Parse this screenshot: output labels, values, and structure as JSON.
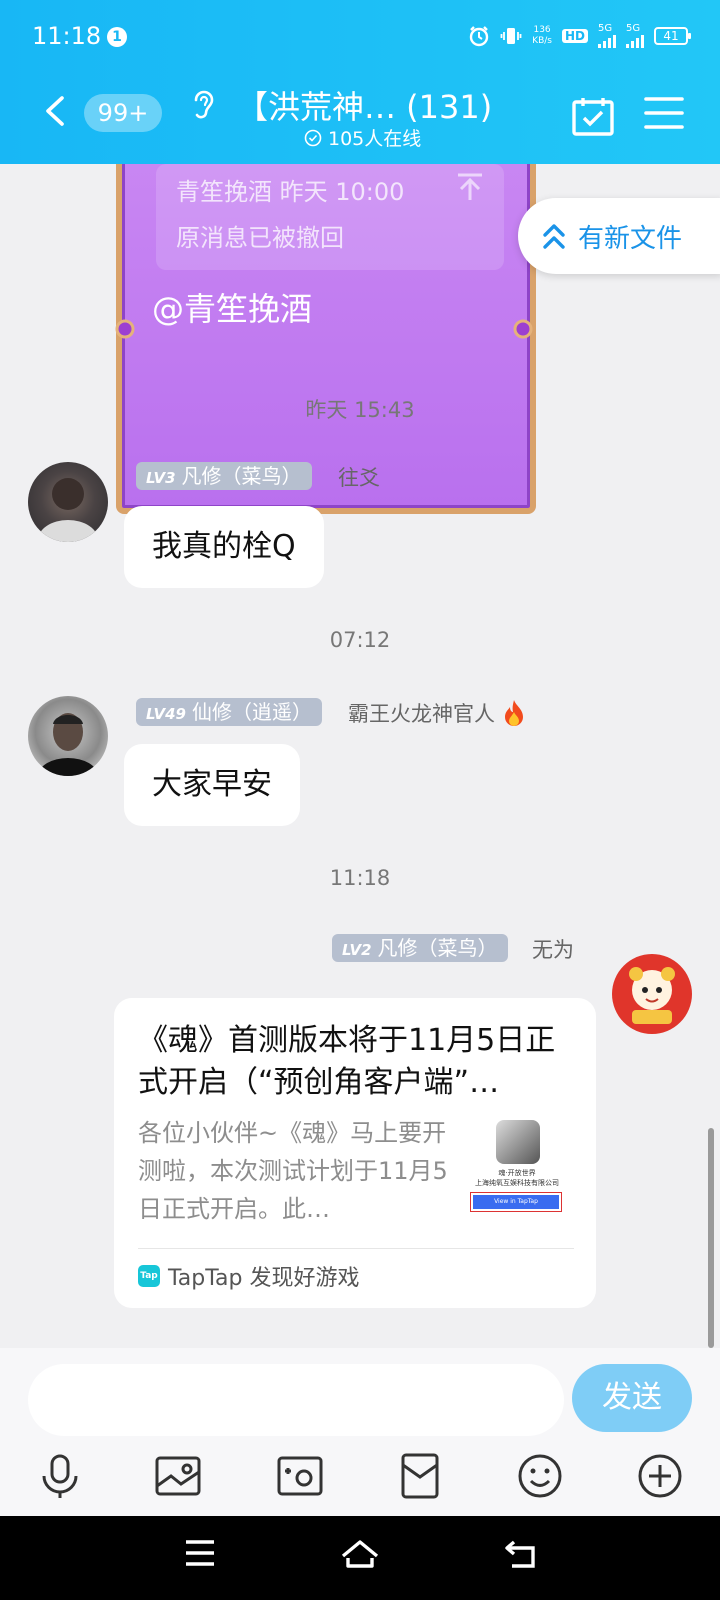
{
  "status_bar": {
    "time": "11:18",
    "notification_count": "1",
    "net_speed_top": "136",
    "net_speed_bottom": "KB/s",
    "hd_label": "HD",
    "sim1_label": "5G",
    "sim2_label": "5G",
    "battery": "41"
  },
  "header": {
    "unread_badge": "99+",
    "title": "【洪荒神… (131)",
    "online": "105人在线"
  },
  "quoted_message": {
    "meta": "青笙挽酒 昨天 10:00",
    "text": "原消息已被撤回",
    "mention": "@青笙挽酒"
  },
  "new_file_button": "有新文件",
  "messages": [
    {
      "timestamp": "昨天 15:43",
      "level": "LV3",
      "title": "凡修（菜鸟）",
      "nickname": "往爻",
      "text": "我真的栓Q"
    },
    {
      "timestamp": "07:12",
      "level": "LV49",
      "title": "仙修（逍遥）",
      "nickname": "霸王火龙神官人",
      "text": "大家早安"
    },
    {
      "timestamp": "11:18",
      "level": "LV2",
      "title": "凡修（菜鸟）",
      "nickname": "无为",
      "share": {
        "title": "《魂》首测版本将于11月5日正式开启（“预创角客户端”…",
        "description": "各位小伙伴~《魂》马上要开测啦，本次测试计划于11月5日正式开启。此…",
        "thumb_line1": "魂·开放世界",
        "thumb_line2": "上海纯氧互娱科技有限公司",
        "thumb_button": "View in TapTap",
        "source": "TapTap 发现好游戏",
        "source_icon_text": "Tap"
      }
    }
  ],
  "composer": {
    "input_value": "",
    "send_label": "发送"
  },
  "toolbar_icons": [
    "microphone-icon",
    "image-icon",
    "camera-icon",
    "red-packet-icon",
    "emoji-icon",
    "plus-icon"
  ],
  "colors": {
    "header_gradient_start": "#18b7f5",
    "header_gradient_end": "#22c7f7",
    "accent_blue": "#1a93e8",
    "send_button": "#7fcdf6",
    "level_tag": "#b6bfcf",
    "purple_card": "#c987f3"
  }
}
